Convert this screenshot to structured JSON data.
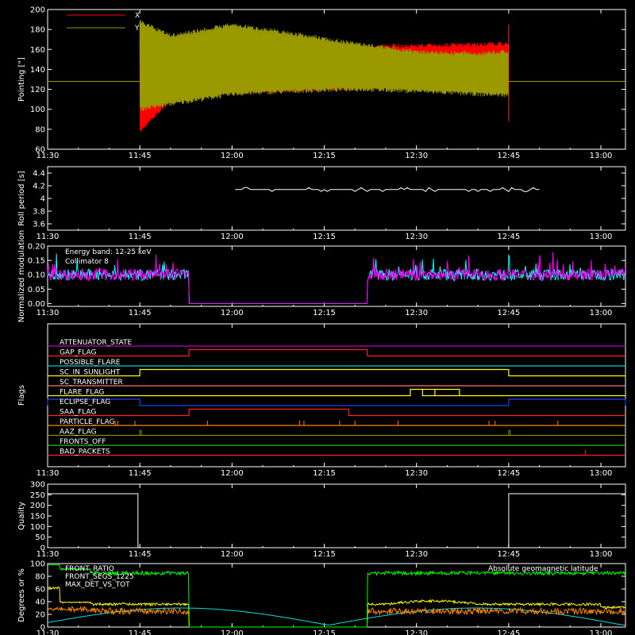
{
  "time_axis": {
    "start_min": 690,
    "end_min": 784,
    "ticks": [
      "11:30",
      "11:45",
      "12:00",
      "12:15",
      "12:30",
      "12:45",
      "13:00"
    ]
  },
  "chart_data": [
    {
      "type": "line",
      "ylabel": "Pointing [\"]",
      "ylim": [
        60,
        200
      ],
      "yticks": [
        60,
        80,
        100,
        120,
        140,
        160,
        180,
        200
      ],
      "legend_position": "top-left",
      "series": [
        {
          "name": "X",
          "color": "#ff0000",
          "baseline": 128,
          "active_range": [
            "11:45",
            "12:45"
          ],
          "envelope_upper": [
            [
              705,
              170
            ],
            [
              710,
              160
            ],
            [
              720,
              158
            ],
            [
              730,
              160
            ],
            [
              740,
              165
            ],
            [
              750,
              166
            ],
            [
              760,
              167
            ],
            [
              765,
              168
            ]
          ],
          "envelope_lower": [
            [
              705,
              75
            ],
            [
              710,
              108
            ],
            [
              720,
              115
            ],
            [
              730,
              117
            ],
            [
              740,
              119
            ],
            [
              750,
              122
            ],
            [
              760,
              127
            ],
            [
              765,
              130
            ]
          ]
        },
        {
          "name": "Y",
          "color": "#9a9a00",
          "baseline": 128,
          "active_range": [
            "11:45",
            "12:45"
          ],
          "envelope_upper": [
            [
              705,
              190
            ],
            [
              710,
              176
            ],
            [
              720,
              187
            ],
            [
              730,
              178
            ],
            [
              740,
              168
            ],
            [
              750,
              160
            ],
            [
              760,
              158
            ],
            [
              765,
              160
            ]
          ],
          "envelope_lower": [
            [
              705,
              98
            ],
            [
              710,
              103
            ],
            [
              720,
              113
            ],
            [
              730,
              116
            ],
            [
              740,
              118
            ],
            [
              750,
              116
            ],
            [
              760,
              113
            ],
            [
              765,
              112
            ]
          ]
        }
      ]
    },
    {
      "type": "line",
      "ylabel": "Roll period [s]",
      "ylim": [
        3.5,
        4.5
      ],
      "yticks": [
        3.6,
        3.8,
        4.0,
        4.2,
        4.4
      ],
      "series": [
        {
          "name": "",
          "color": "#ffffff",
          "value": 4.14,
          "range": [
            "12:00",
            "12:50"
          ]
        }
      ]
    },
    {
      "type": "line",
      "ylabel": "Normalized modulation",
      "ylim": [
        -0.01,
        0.2
      ],
      "yticks": [
        0.0,
        0.05,
        0.1,
        0.15,
        0.2
      ],
      "tick_labels": [
        "0.00",
        "0.05",
        "0.10",
        "0.15",
        "0.20"
      ],
      "annotations": [
        "Energy band: 12-25 keV",
        "Collimator 8"
      ],
      "series": [
        {
          "name": "Collimator 8",
          "color": "#00ffff",
          "mean": 0.1
        },
        {
          "name": "",
          "color": "#ff00ff",
          "mean": 0.1
        }
      ],
      "zero_interval": [
        "11:53",
        "12:22"
      ]
    },
    {
      "type": "line",
      "ylabel": "Flags",
      "flags": [
        {
          "name": "ATTENUATOR_STATE",
          "color": "#c000c0",
          "intervals": []
        },
        {
          "name": "GAP_FLAG",
          "color": "#ff2020",
          "intervals": [
            [
              "11:53",
              "12:22"
            ]
          ]
        },
        {
          "name": "POSSIBLE_FLARE",
          "color": "#00c8c8",
          "intervals": []
        },
        {
          "name": "SC_IN_SUNLIGHT",
          "color": "#ffff00",
          "intervals": [
            [
              "11:45",
              "12:45"
            ]
          ]
        },
        {
          "name": "SC_TRANSMITTER",
          "color": "#ff7070",
          "intervals": []
        },
        {
          "name": "FLARE_FLAG",
          "color": "#ffff00",
          "intervals": [
            [
              "12:29",
              "12:37"
            ],
            [
              "12:31",
              "12:33"
            ]
          ]
        },
        {
          "name": "ECLIPSE_FLAG",
          "color": "#2040ff",
          "intervals": [
            [
              "11:30",
              "11:45"
            ],
            [
              "12:45",
              "13:04"
            ]
          ]
        },
        {
          "name": "SAA_FLAG",
          "color": "#ff2020",
          "intervals": [
            [
              "11:53",
              "12:19"
            ]
          ]
        },
        {
          "name": "PARTICLE_FLAG",
          "color": "#ff8000",
          "intervals": []
        },
        {
          "name": "AAZ_FLAG",
          "color": "#8a8a00",
          "intervals": []
        },
        {
          "name": "FRONTS_OFF",
          "color": "#20c020",
          "intervals": []
        },
        {
          "name": "BAD_PACKETS",
          "color": "#ff2020",
          "intervals": []
        }
      ]
    },
    {
      "type": "line",
      "ylabel": "Quality",
      "ylim": [
        0,
        300
      ],
      "yticks": [
        0,
        50,
        100,
        150,
        200,
        250,
        300
      ],
      "series": [
        {
          "name": "",
          "color": "#ffffff",
          "points": [
            [
              690,
              255
            ],
            [
              704.7,
              255
            ],
            [
              704.7,
              0
            ],
            [
              765,
              0
            ],
            [
              765,
              255
            ],
            [
              784,
              255
            ]
          ]
        }
      ]
    },
    {
      "type": "line",
      "ylabel": "Degrees or %",
      "ylim": [
        0,
        100
      ],
      "yticks": [
        0,
        20,
        40,
        60,
        80,
        100
      ],
      "legend_position": "top-left",
      "series": [
        {
          "name": "FRONT_RATIO",
          "color": "#ffff00",
          "mean": 38
        },
        {
          "name": "FRONT_SEGS_1225",
          "color": "#00ff00",
          "mean": 85
        },
        {
          "name": "MAX_DET_VS_TOT",
          "color": "#ff8800",
          "mean": 25
        },
        {
          "name": "Absolute geomagnetic latitude",
          "color": "#00e0e0"
        }
      ]
    }
  ]
}
